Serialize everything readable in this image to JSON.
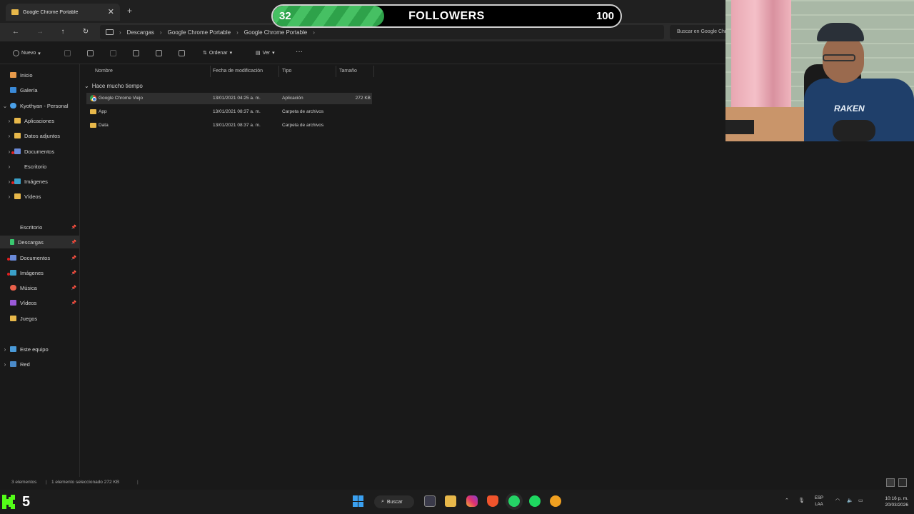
{
  "window": {
    "tab_title": "Google Chrome Portable",
    "new_tab_glyph": "+",
    "close_glyph": "✕"
  },
  "addressbar": {
    "back": "←",
    "forward": "→",
    "up": "↑",
    "refresh": "↻",
    "breadcrumbs": [
      "Descargas",
      "Google Chrome Portable",
      "Google Chrome Portable"
    ],
    "separator": "›",
    "search_placeholder": "Buscar en Google Chrome Portable"
  },
  "toolbar": {
    "new_label": "Nuevo",
    "sort_label": "Ordenar",
    "view_label": "Ver",
    "more": "···"
  },
  "sidebar": {
    "home": "Inicio",
    "gallery": "Galería",
    "onedrive": "Kyothyan - Personal",
    "onedrive_children": [
      "Aplicaciones",
      "Datos adjuntos",
      "Documentos",
      "Escritorio",
      "Imágenes",
      "Vídeos"
    ],
    "quick_access": [
      "Escritorio",
      "Descargas",
      "Documentos",
      "Imágenes",
      "Música",
      "Vídeos",
      "Juegos"
    ],
    "this_pc": "Este equipo",
    "network": "Red"
  },
  "content": {
    "columns": [
      "Nombre",
      "Fecha de modificación",
      "Tipo",
      "Tamaño"
    ],
    "group_title": "Hace mucho tiempo",
    "rows": [
      {
        "name": "Google Chrome Viejo",
        "date": "13/01/2021 04:25 a. m.",
        "type": "Aplicación",
        "size": "272 KB",
        "icon": "chrome-icon",
        "selected": true
      },
      {
        "name": "App",
        "date": "13/01/2021 08:37 a. m.",
        "type": "Carpeta de archivos",
        "size": "",
        "icon": "folder-icon"
      },
      {
        "name": "Data",
        "date": "13/01/2021 08:37 a. m.",
        "type": "Carpeta de archivos",
        "size": "",
        "icon": "folder-icon"
      }
    ]
  },
  "statusbar": {
    "count": "3 elementos",
    "selection": "1 elemento seleccionado  272 KB"
  },
  "followers_goal": {
    "current": "32",
    "label": "FOLLOWERS",
    "goal": "100",
    "progress_fraction": 0.32,
    "fill_color": "#3fb55a"
  },
  "webcam": {
    "shirt_text": "RAKEN"
  },
  "taskbar": {
    "kick_count": "5",
    "kick_color": "#53fc18",
    "search_label": "Buscar",
    "lang_line1": "ESP",
    "lang_line2": "LAA",
    "time": "10:16 p. m.",
    "date": "20/03/2026"
  }
}
